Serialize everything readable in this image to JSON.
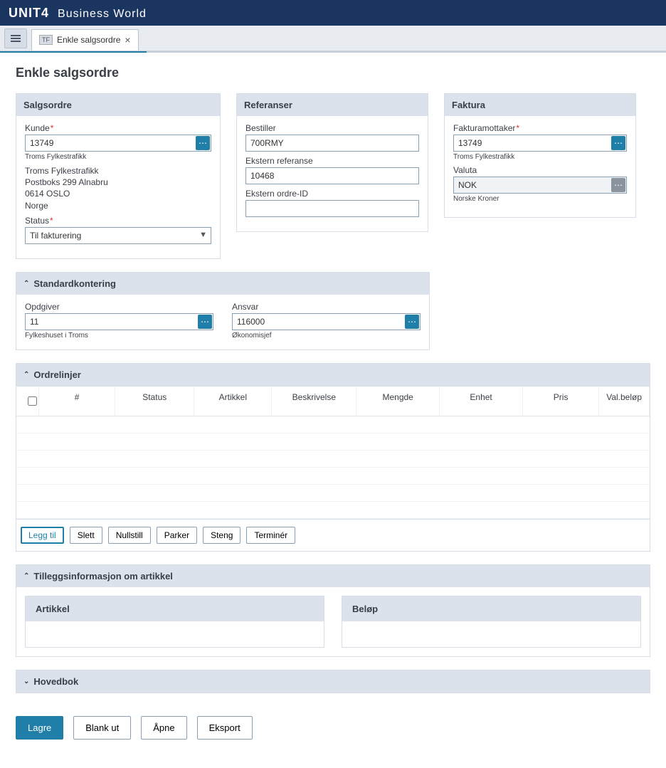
{
  "app": {
    "logo1": "UNIT",
    "logo2": "4",
    "subtitle": "Business World"
  },
  "tab": {
    "badge": "TF",
    "title": "Enkle salgsordre"
  },
  "page": {
    "title": "Enkle salgsordre"
  },
  "salgsordre": {
    "title": "Salgsordre",
    "kunde_label": "Kunde",
    "kunde_value": "13749",
    "kunde_help": "Troms Fylkestrafikk",
    "addr1": "Troms Fylkestrafikk",
    "addr2": "Postboks 299 Alnabru",
    "addr3": "0614 OSLO",
    "addr4": "Norge",
    "status_label": "Status",
    "status_value": "Til fakturering"
  },
  "referanser": {
    "title": "Referanser",
    "bestiller_label": "Bestiller",
    "bestiller_value": "700RMY",
    "ekstref_label": "Ekstern referanse",
    "ekstref_value": "10468",
    "ekstord_label": "Ekstern ordre-ID",
    "ekstord_value": ""
  },
  "faktura": {
    "title": "Faktura",
    "mottaker_label": "Fakturamottaker",
    "mottaker_value": "13749",
    "mottaker_help": "Troms Fylkestrafikk",
    "valuta_label": "Valuta",
    "valuta_value": "NOK",
    "valuta_help": "Norske Kroner"
  },
  "stdkont": {
    "title": "Standardkontering",
    "opdgiver_label": "Opdgiver",
    "opdgiver_value": "11",
    "opdgiver_help": "Fylkeshuset i Troms",
    "ansvar_label": "Ansvar",
    "ansvar_value": "116000",
    "ansvar_help": "Økonomisjef"
  },
  "ordrelinjer": {
    "title": "Ordrelinjer",
    "cols": {
      "num": "#",
      "status": "Status",
      "artikkel": "Artikkel",
      "beskrivelse": "Beskrivelse",
      "mengde": "Mengde",
      "enhet": "Enhet",
      "pris": "Pris",
      "valbelop": "Val.beløp"
    },
    "actions": {
      "leggtil": "Legg til",
      "slett": "Slett",
      "nullstill": "Nullstill",
      "parker": "Parker",
      "steng": "Steng",
      "terminer": "Terminér"
    }
  },
  "tillegg": {
    "title": "Tilleggsinformasjon om artikkel",
    "artikkel": "Artikkel",
    "belop": "Beløp"
  },
  "hovedbok": {
    "title": "Hovedbok"
  },
  "footer": {
    "lagre": "Lagre",
    "blankut": "Blank ut",
    "apne": "Åpne",
    "eksport": "Eksport"
  }
}
